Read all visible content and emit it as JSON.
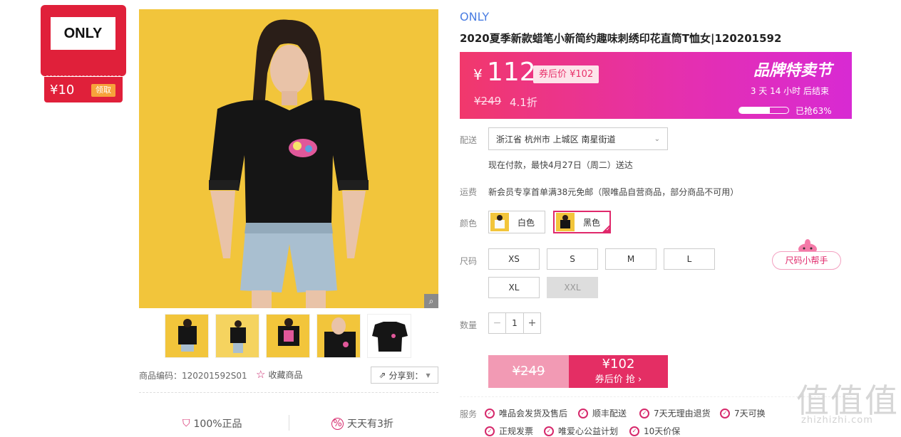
{
  "brand_badge": {
    "logo_text": "ONLY",
    "coupon_amount": "¥10",
    "coupon_button": "领取"
  },
  "gallery": {
    "thumb_count": 5,
    "sku_code": "商品编码：120201592S01",
    "favorite_label": "收藏商品",
    "share_label": "分享到："
  },
  "guarantees": [
    {
      "label": "100%正品",
      "icon": "shield-check-icon"
    },
    {
      "label": "天天有3折",
      "icon": "percent-badge-icon"
    }
  ],
  "product": {
    "brand": "ONLY",
    "title": "2020夏季新款蜡笔小新简约趣味刺绣印花直筒T恤女|120201592"
  },
  "price": {
    "yen": "¥",
    "current": "112",
    "after_coupon": "券后价 ¥102",
    "original": "¥249",
    "discount": "4.1折",
    "festival": "品牌特卖节",
    "countdown": "3  天 14 小时 后结束",
    "sold_percent": 63,
    "sold_label": "已抢63%"
  },
  "delivery": {
    "label": "配送",
    "address": "浙江省 杭州市 上城区 南星街道",
    "eta": "现在付款，最快4月27日（周二）送达"
  },
  "shipping": {
    "label": "运费",
    "text": "新会员专享首单满38元免邮（限唯品自营商品，部分商品不可用）"
  },
  "colors": {
    "label": "颜色",
    "options": [
      {
        "name": "白色",
        "selected": false
      },
      {
        "name": "黑色",
        "selected": true
      }
    ]
  },
  "sizes": {
    "label": "尺码",
    "options": [
      {
        "name": "XS",
        "disabled": false
      },
      {
        "name": "S",
        "disabled": false
      },
      {
        "name": "M",
        "disabled": false
      },
      {
        "name": "L",
        "disabled": false
      },
      {
        "name": "XL",
        "disabled": false
      },
      {
        "name": "XXL",
        "disabled": true
      }
    ],
    "helper": "尺码小帮手"
  },
  "quantity": {
    "label": "数量",
    "value": "1",
    "minus": "−",
    "plus": "+"
  },
  "buy": {
    "original": "¥249",
    "price": "¥102",
    "sub": "券后价 抢 ›"
  },
  "services": {
    "label": "服务",
    "items": [
      "唯品会发货及售后",
      "顺丰配送",
      "7天无理由退货",
      "7天可换",
      "正规发票",
      "唯爱心公益计划",
      "10天价保"
    ]
  },
  "watermark": {
    "text": "值值值",
    "url": "zhizhizhi.com"
  },
  "colors_theme": {
    "accent": "#e42e64",
    "link": "#4a7de2",
    "badge": "#e0203a",
    "photo_bg": "#f2c53b"
  }
}
